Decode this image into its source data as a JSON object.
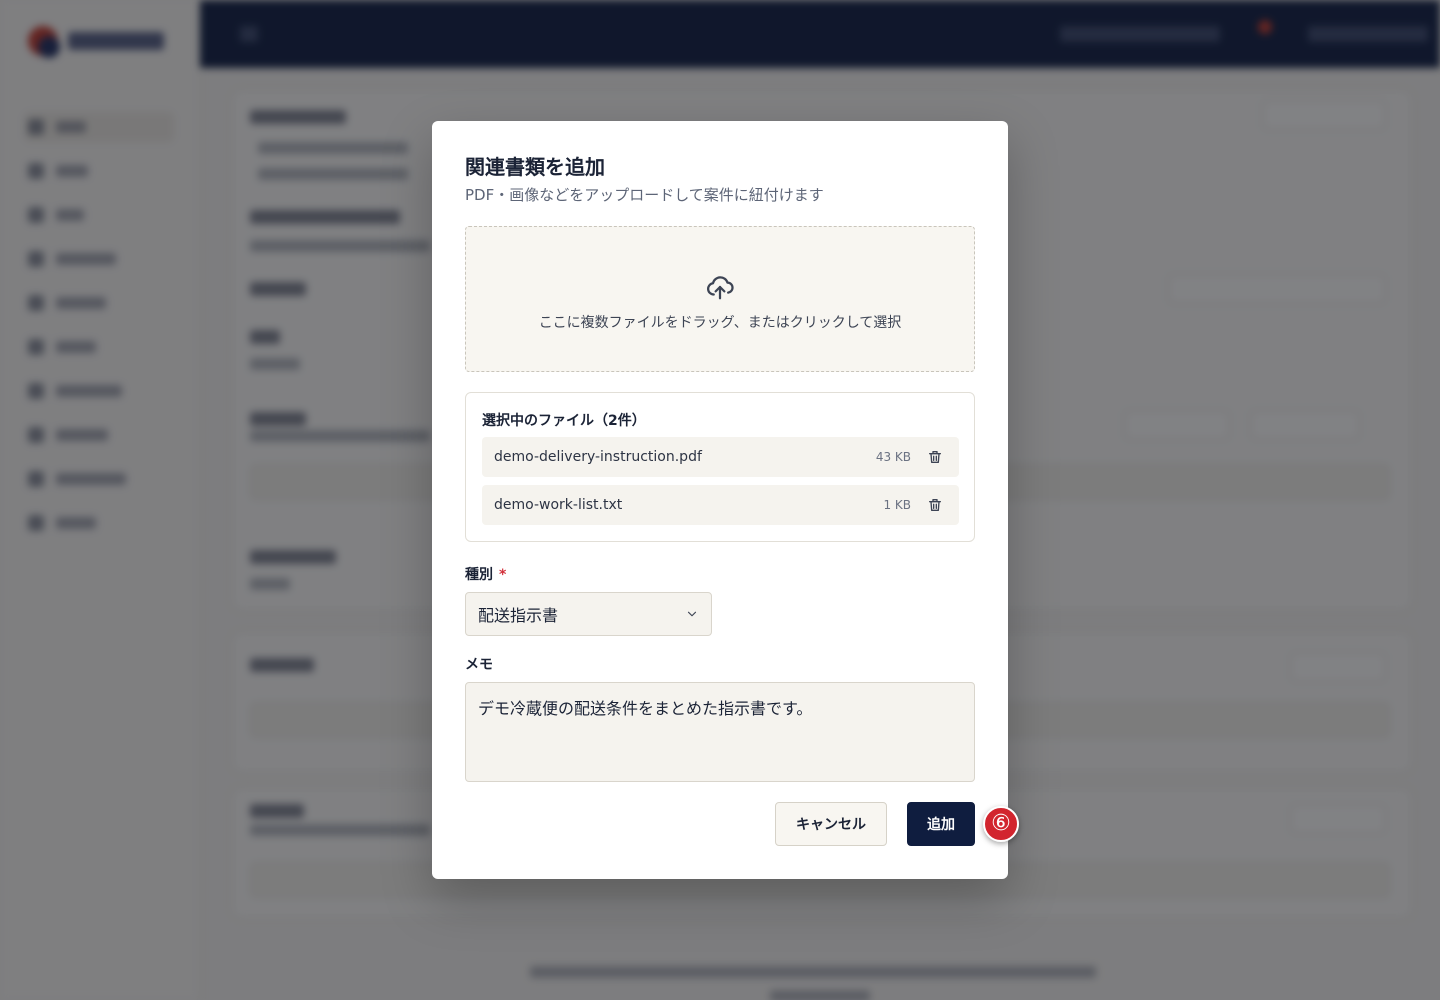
{
  "modal": {
    "title": "関連書類を追加",
    "subtitle": "PDF・画像などをアップロードして案件に紐付けます",
    "dropzone_text": "ここに複数ファイルをドラッグ、またはクリックして選択",
    "files_heading": "選択中のファイル（2件）",
    "files": [
      {
        "name": "demo-delivery-instruction.pdf",
        "size": "43 KB"
      },
      {
        "name": "demo-work-list.txt",
        "size": "1 KB"
      }
    ],
    "type_label": "種別",
    "required_mark": "*",
    "type_value": "配送指示書",
    "memo_label": "メモ",
    "memo_value": "デモ冷蔵便の配送条件をまとめた指示書です。",
    "cancel_label": "キャンセル",
    "add_label": "追加"
  },
  "step_badge": "⑥",
  "colors": {
    "primary": "#0f1d3f",
    "required": "#d2303a",
    "badge": "#d2252e"
  },
  "icons": {
    "dropzone": "cloud-upload-icon",
    "remove": "trash-icon",
    "select": "chevron-down-icon"
  }
}
